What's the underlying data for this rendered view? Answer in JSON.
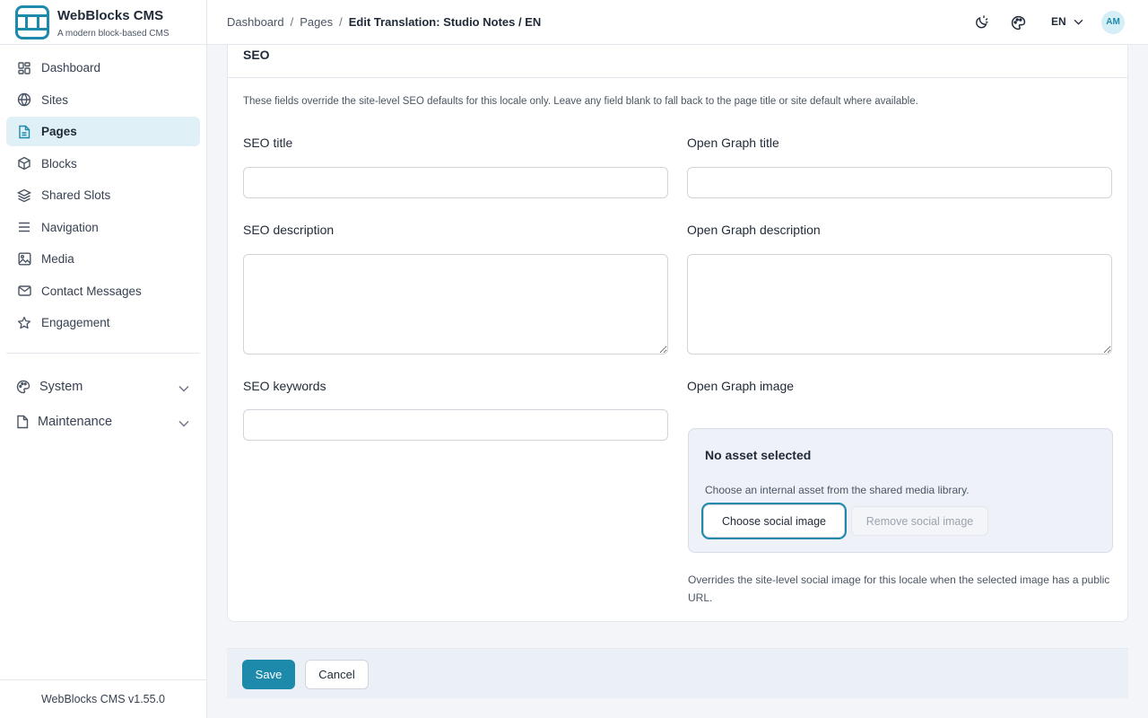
{
  "brand": {
    "title": "WebBlocks CMS",
    "subtitle": "A modern block-based CMS"
  },
  "sidebar": {
    "items": [
      {
        "label": "Dashboard",
        "icon": "dashboard-grid-icon"
      },
      {
        "label": "Sites",
        "icon": "globe-icon"
      },
      {
        "label": "Pages",
        "icon": "document-icon",
        "active": true
      },
      {
        "label": "Blocks",
        "icon": "cube-icon"
      },
      {
        "label": "Shared Slots",
        "icon": "layers-icon"
      },
      {
        "label": "Navigation",
        "icon": "menu-lines-icon"
      },
      {
        "label": "Media",
        "icon": "image-icon"
      },
      {
        "label": "Contact Messages",
        "icon": "envelope-icon"
      },
      {
        "label": "Engagement",
        "icon": "star-icon"
      }
    ],
    "groups": [
      {
        "label": "System",
        "icon": "palette-icon"
      },
      {
        "label": "Maintenance",
        "icon": "file-icon"
      }
    ],
    "version": "WebBlocks CMS v1.55.0"
  },
  "header": {
    "breadcrumb": [
      "Dashboard",
      "Pages",
      "Edit Translation: Studio Notes / EN"
    ],
    "language": "EN",
    "avatar": "AM"
  },
  "seo": {
    "title": "SEO",
    "description": "These fields override the site-level SEO defaults for this locale only. Leave any field blank to fall back to the page title or site default where available.",
    "seo_title_label": "SEO title",
    "seo_title_value": "",
    "og_title_label": "Open Graph title",
    "og_title_value": "",
    "seo_description_label": "SEO description",
    "og_description_label": "Open Graph description",
    "seo_keywords_label": "SEO keywords",
    "seo_keywords_value": "",
    "og_image_label": "Open Graph image",
    "og_image": {
      "title": "No asset selected",
      "text": "Choose an internal asset from the shared media library.",
      "choose_label": "Choose social image",
      "remove_label": "Remove social image"
    },
    "og_help": "Overrides the site-level social image for this locale when the selected image has a public URL."
  },
  "actions": {
    "save_label": "Save",
    "cancel_label": "Cancel"
  },
  "colors": {
    "accent": "#1d8aab",
    "active_bg": "#dff0f6"
  }
}
